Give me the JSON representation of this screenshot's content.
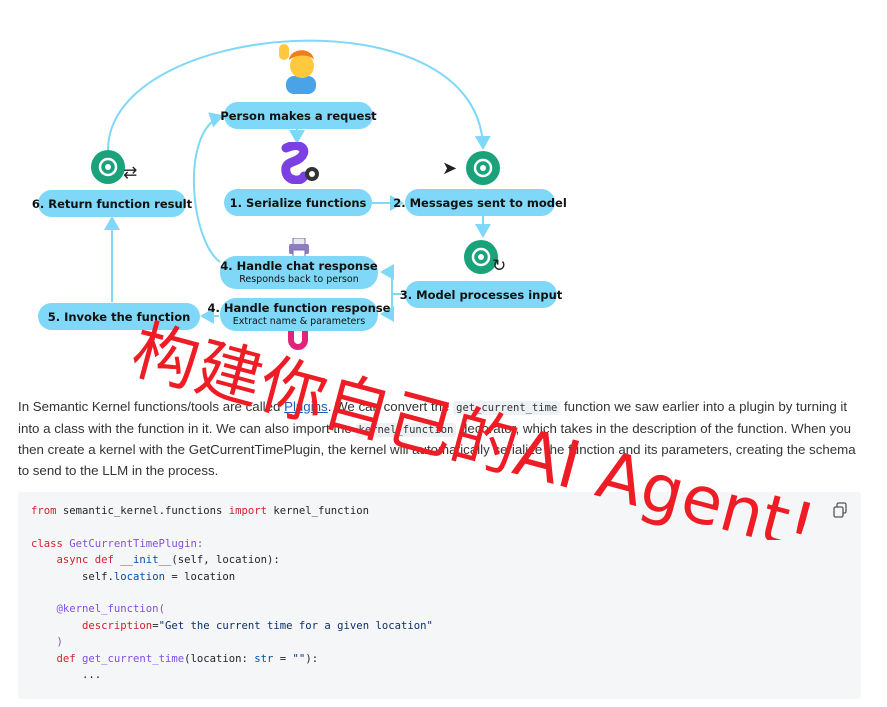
{
  "diagram": {
    "steps": {
      "request": "Person makes a request",
      "serialize": "1. Serialize functions",
      "messages": "2. Messages sent to model",
      "process": "3. Model processes input",
      "handle_function": "4. Handle function response",
      "handle_function_sub": "Extract name & parameters",
      "handle_chat": "4. Handle chat response",
      "handle_chat_sub": "Responds back to person",
      "invoke": "5. Invoke the function",
      "return": "6. Return function result"
    },
    "colors": {
      "pill": "#7fd8f7",
      "arrow": "#7fd8f7",
      "model": "#1aa37a"
    }
  },
  "paragraph": {
    "t1": "In Semantic Kernel functions/tools are called ",
    "link": "Plugins",
    "t2": ". We can convert the ",
    "code1": "get_current_time",
    "t3": " function we saw earlier into a plugin by turning it into a class with the function in it. We can also import the ",
    "code2": "kernel_function",
    "t4": " decorator, which takes in the description of the function. When you then create a kernel with the GetCurrentTimePlugin, the kernel will automatically serialize the function and its parameters, creating the schema to send to the LLM in the process."
  },
  "code": {
    "line1_kw1": "from",
    "line1_mod": " semantic_kernel.functions ",
    "line1_kw2": "import",
    "line1_name": " kernel_function",
    "line3_kw": "class",
    "line3_name": " GetCurrentTimePlugin:",
    "line4_indent": "    ",
    "line4_kw": "async def",
    "line4_fn": " __init__",
    "line4_rest": "(self, location):",
    "line5_pre": "        self.",
    "line5_attr": "location",
    "line5_rest": " = location",
    "line7_indent": "    ",
    "line7_deco": "@kernel_function(",
    "line8_indent": "        ",
    "line8_param": "description",
    "line8_eq": "=",
    "line8_str": "\"Get the current time for a given location\"",
    "line9": "    )",
    "line10_indent": "    ",
    "line10_kw": "def",
    "line10_fn": " get_current_time",
    "line10_a": "(location: ",
    "line10_type": "str",
    "line10_b": " = ",
    "line10_str": "\"\"",
    "line10_c": "):",
    "line11": "        ..."
  },
  "copy_icon": "copy-icon",
  "watermark": {
    "text": "构建你自己的AI Agent!",
    "color": "#ee1c25"
  }
}
